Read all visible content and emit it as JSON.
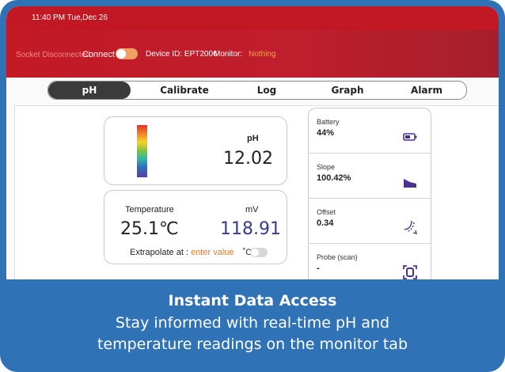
{
  "status_bar": {
    "time": "11:40 PM Tue,Dec 26"
  },
  "connection": {
    "socket_status": "Socket Disconnected",
    "connect_label": "Connect",
    "device_id": "Device ID: EPT2006",
    "monitor_label": "Monitor:",
    "monitor_value": "Nothing"
  },
  "tabs": [
    {
      "label": "pH",
      "active": true
    },
    {
      "label": "Calibrate",
      "active": false
    },
    {
      "label": "Log",
      "active": false
    },
    {
      "label": "Graph",
      "active": false
    },
    {
      "label": "Alarm",
      "active": false
    }
  ],
  "ph_card": {
    "label": "pH",
    "value": "12.02"
  },
  "temp_card": {
    "temperature_label": "Temperature",
    "temperature_value": "25.1℃",
    "mv_label": "mV",
    "mv_value": "118.91",
    "extrapolate_label": "Extrapolate at :",
    "extrapolate_placeholder": "enter value",
    "unit": "˚C"
  },
  "side_panel": [
    {
      "label": "Battery",
      "value": "44%",
      "icon": "battery-icon"
    },
    {
      "label": "Slope",
      "value": "100.42%",
      "icon": "slope-icon"
    },
    {
      "label": "Offset",
      "value": "0.34",
      "icon": "offset-icon"
    },
    {
      "label": "Probe (scan)",
      "value": "-",
      "icon": "probe-scan-icon"
    }
  ],
  "caption": {
    "title": "Instant Data Access",
    "line1": "Stay informed with real-time pH and",
    "line2": "temperature readings on the monitor tab"
  },
  "colors": {
    "frame_blue": "#2f72b6",
    "header_red": "#c31a26",
    "accent_orange": "#e87a2d",
    "icon_purple": "#4a3490",
    "mv_value": "#3a3a8c"
  }
}
